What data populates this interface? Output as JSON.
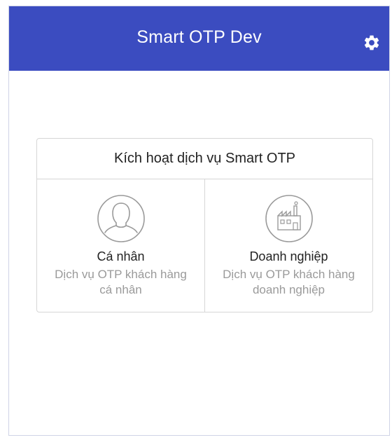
{
  "header": {
    "title": "Smart OTP Dev",
    "icon": "gear-icon",
    "background_color": "#3b4cc0"
  },
  "activation": {
    "title": "Kích hoạt dịch vụ Smart OTP",
    "options": [
      {
        "icon": "person-icon",
        "label": "Cá nhân",
        "description": "Dịch vụ OTP khách hàng cá nhân"
      },
      {
        "icon": "factory-icon",
        "label": "Doanh nghiệp",
        "description": "Dịch vụ OTP khách hàng doanh nghiệp"
      }
    ]
  }
}
